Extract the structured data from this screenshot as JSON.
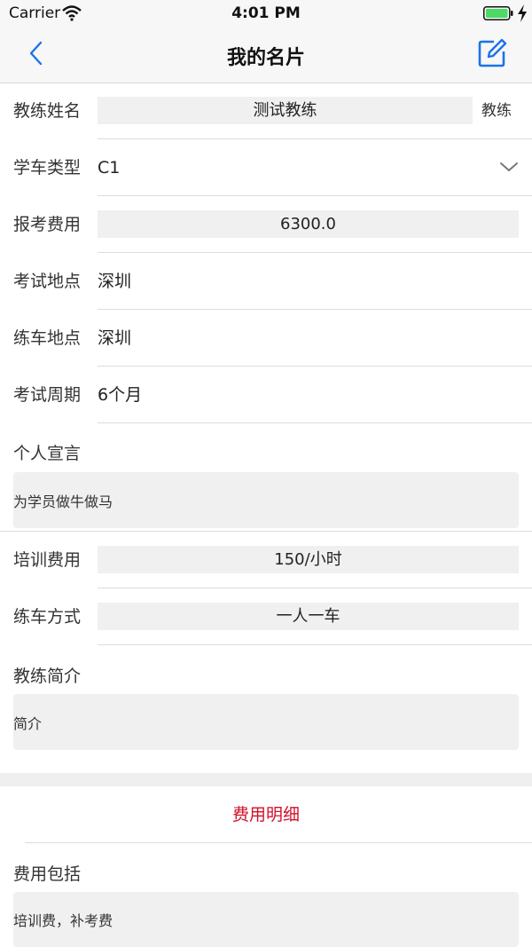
{
  "status": {
    "carrier": "Carrier",
    "time": "4:01 PM"
  },
  "nav": {
    "title": "我的名片",
    "back_icon": "chevron-left-icon",
    "edit_icon": "edit-icon",
    "accent": "#1a73e8"
  },
  "form": {
    "coach_name": {
      "label": "教练姓名",
      "value": "测试教练",
      "suffix": "教练"
    },
    "car_type": {
      "label": "学车类型",
      "value": "C1"
    },
    "exam_fee": {
      "label": "报考费用",
      "value": "6300.0"
    },
    "exam_place": {
      "label": "考试地点",
      "value": "深圳"
    },
    "practice_place": {
      "label": "练车地点",
      "value": "深圳"
    },
    "exam_period": {
      "label": "考试周期",
      "value": "6个月"
    },
    "motto": {
      "label": "个人宣言",
      "value": "为学员做牛做马"
    },
    "training_fee": {
      "label": "培训费用",
      "value": "150/小时"
    },
    "practice_mode": {
      "label": "练车方式",
      "value": "一人一车"
    },
    "intro": {
      "label": "教练简介",
      "value": "简介"
    }
  },
  "fees": {
    "detail_link": "费用明细",
    "link_color": "#d0102a",
    "includes_label": "费用包括",
    "includes_value": "培训费，补考费"
  }
}
